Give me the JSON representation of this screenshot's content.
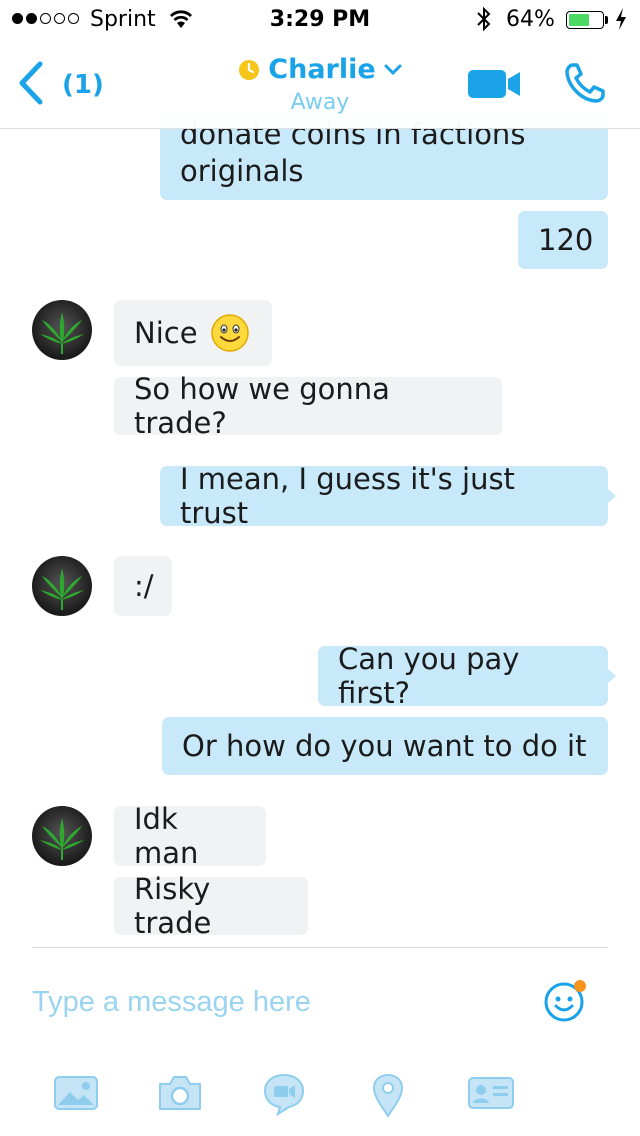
{
  "status_bar": {
    "carrier": "Sprint",
    "time": "3:29 PM",
    "battery_percent": "64%",
    "battery_level": 0.64,
    "signal_bars_filled": 2,
    "signal_bars_total": 5
  },
  "header": {
    "back_count": "(1)",
    "contact_name": "Charlie",
    "contact_status": "Away",
    "accent_color": "#1aa3e8",
    "status_color": "#f5c518"
  },
  "messages": [
    {
      "direction": "out",
      "text": "donate coins in factions\noriginals"
    },
    {
      "direction": "out",
      "text": "120"
    },
    {
      "direction": "in",
      "text": "Nice",
      "emoji": "smiley-emoji"
    },
    {
      "direction": "in",
      "text": "So how we gonna trade?"
    },
    {
      "direction": "out",
      "text": "I mean, I guess it's just trust"
    },
    {
      "direction": "in",
      "text": ":/"
    },
    {
      "direction": "out",
      "text": "Can you pay first?"
    },
    {
      "direction": "out",
      "text": "Or how do you want to do it"
    },
    {
      "direction": "in",
      "text": "Idk man"
    },
    {
      "direction": "in",
      "text": "Risky trade"
    }
  ],
  "composer": {
    "placeholder": "Type a message here",
    "value": ""
  },
  "toolbar": [
    {
      "icon": "photos-icon"
    },
    {
      "icon": "camera-icon"
    },
    {
      "icon": "video-message-icon"
    },
    {
      "icon": "location-icon"
    },
    {
      "icon": "contact-card-icon"
    }
  ]
}
